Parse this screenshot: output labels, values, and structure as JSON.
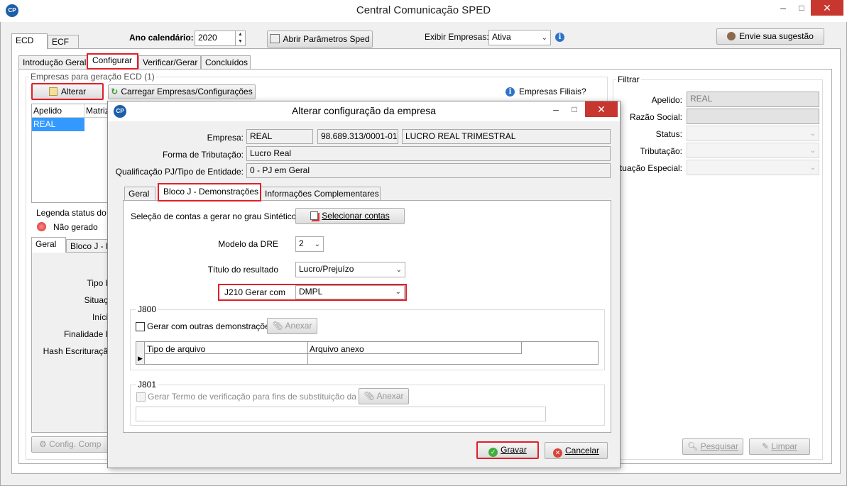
{
  "window": {
    "title": "Central Comunicação SPED",
    "logo": "CP"
  },
  "main_tabs": [
    "ECD",
    "ECF"
  ],
  "toolbar": {
    "ano_label": "Ano calendário:",
    "ano_value": "2020",
    "abrir_params": "Abrir Parâmetros Sped",
    "exibir_label": "Exibir Empresas:",
    "exibir_value": "Ativa",
    "sugestao": "Envie sua sugestão"
  },
  "sub_tabs": [
    "Introdução Geral",
    "Configurar",
    "Verificar/Gerar",
    "Concluídos"
  ],
  "empresas": {
    "group_title": "Empresas para geração ECD (1)",
    "alterar": "Alterar",
    "carregar": "Carregar Empresas/Configurações",
    "filiais": "Empresas Filiais?",
    "columns": [
      "Apelido",
      "Matriz"
    ],
    "rows": [
      [
        "REAL",
        ""
      ]
    ],
    "legenda": "Legenda status do",
    "status_nao_gerado": "Não gerado",
    "detail_tabs": [
      "Geral",
      "Bloco J - D"
    ],
    "detail_labels": [
      "Tipo I",
      "Situaç",
      "Iníci",
      "Finalidade I",
      "Hash Escrituraçã"
    ],
    "config_comp": "Config. Comp"
  },
  "filtrar": {
    "title": "Filtrar",
    "apelido_label": "Apelido:",
    "apelido_value": "REAL",
    "razao_label": "Razão Social:",
    "status_label": "Status:",
    "tributacao_label": "Tributação:",
    "situacao_label": "ituação Especial:",
    "pesquisar": "Pesquisar",
    "limpar": "Limpar"
  },
  "dialog": {
    "title": "Alterar configuração da empresa",
    "empresa_label": "Empresa:",
    "empresa_nome": "REAL",
    "empresa_cnpj": "98.689.313/0001-01",
    "empresa_regime": "LUCRO REAL TRIMESTRAL",
    "forma_label": "Forma de Tributação:",
    "forma_value": "Lucro Real",
    "qualif_label": "Qualificação PJ/Tipo de Entidade:",
    "qualif_value": "0 - PJ em Geral",
    "tabs": [
      "Geral",
      "Bloco J - Demonstrações",
      "Informações Complementares"
    ],
    "selecao_label": "Seleção de contas a gerar no grau Sintético",
    "selecionar_contas": "Selecionar contas",
    "modelo_label": "Modelo da DRE",
    "modelo_value": "2",
    "titulo_label": "Título do resultado",
    "titulo_value": "Lucro/Prejuízo",
    "j210_label": "J210 Gerar com",
    "j210_value": "DMPL",
    "j800_title": "J800",
    "j800_check": "Gerar com outras demonstrações",
    "anexar": "Anexar",
    "grid_cols": [
      "Tipo de arquivo",
      "Arquivo anexo"
    ],
    "j801_title": "J801",
    "j801_check": "Gerar Termo de verificação para fins de substituição da ECD",
    "gravar": "Gravar",
    "cancelar": "Cancelar"
  },
  "colors": {
    "highlight": "#e0202a",
    "selection": "#3399ff",
    "accent": "#2d73c9"
  }
}
